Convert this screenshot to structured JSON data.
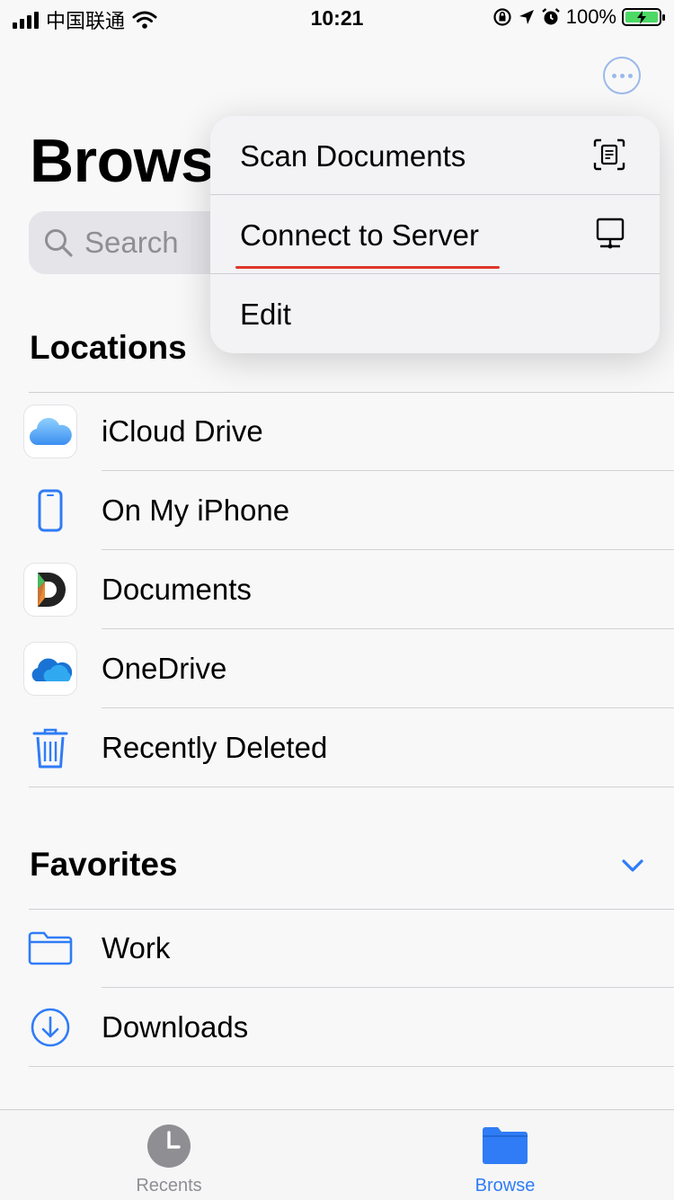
{
  "status_bar": {
    "carrier": "中国联通",
    "time": "10:21",
    "battery_percent": "100%"
  },
  "header": {
    "title": "Browse",
    "more_icon": "ellipsis-circle-icon"
  },
  "search": {
    "placeholder": "Search"
  },
  "menu": {
    "items": [
      {
        "label": "Scan Documents",
        "icon": "scan-document-icon"
      },
      {
        "label": "Connect to Server",
        "icon": "server-icon"
      },
      {
        "label": "Edit"
      }
    ]
  },
  "locations": {
    "title": "Locations",
    "items": [
      {
        "label": "iCloud Drive",
        "icon": "icloud-icon"
      },
      {
        "label": "On My iPhone",
        "icon": "iphone-icon"
      },
      {
        "label": "Documents",
        "icon": "documents-app-icon"
      },
      {
        "label": "OneDrive",
        "icon": "onedrive-icon"
      },
      {
        "label": "Recently Deleted",
        "icon": "trash-icon"
      }
    ]
  },
  "favorites": {
    "title": "Favorites",
    "items": [
      {
        "label": "Work",
        "icon": "folder-icon"
      },
      {
        "label": "Downloads",
        "icon": "download-icon"
      }
    ]
  },
  "tab_bar": {
    "tabs": [
      {
        "label": "Recents",
        "icon": "clock-icon",
        "selected": false
      },
      {
        "label": "Browse",
        "icon": "folder-filled-icon",
        "selected": true
      }
    ]
  },
  "colors": {
    "accent": "#2f7cf6",
    "annotation": "#e0372b",
    "inactive": "#8e8e93"
  }
}
